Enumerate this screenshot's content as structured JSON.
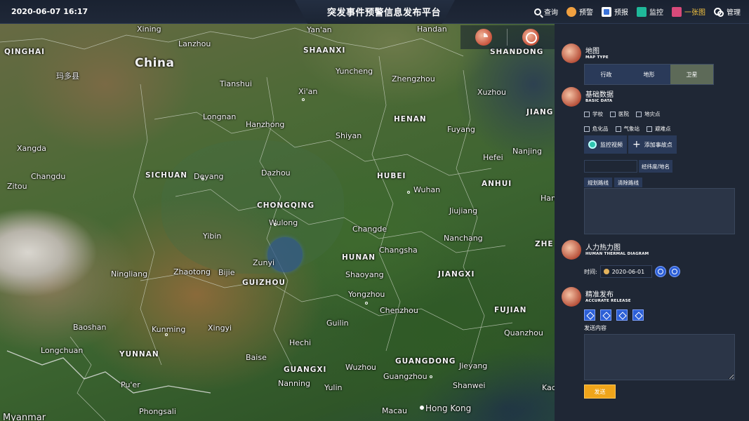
{
  "header": {
    "datetime": "2020-06-07 16:17",
    "title": "突发事件预警信息发布平台",
    "nav": [
      {
        "label": "查询",
        "icon": "search-icon"
      },
      {
        "label": "预警",
        "icon": "warning-icon"
      },
      {
        "label": "预报",
        "icon": "forecast-icon"
      },
      {
        "label": "监控",
        "icon": "monitor-icon"
      },
      {
        "label": "一张图",
        "icon": "map-icon",
        "active": true
      },
      {
        "label": "管理",
        "icon": "manage-icon"
      }
    ]
  },
  "map": {
    "labels": {
      "xining": "Xining",
      "lanzhou": "Lanzhou",
      "yanan": "Yan'an",
      "handan": "Handan",
      "qinghai": "QINGHAI",
      "shaanxi": "SHAANXI",
      "shandong": "SHANDONG",
      "china": "China",
      "maduo": "玛多县",
      "yuncheng": "Yuncheng",
      "zhengzhou": "Zhengzhou",
      "tianshui": "Tianshui",
      "xian": "Xi'an",
      "xuzhou": "Xuzhou",
      "longnan": "Longnan",
      "hanzhong": "Hanzhong",
      "henan": "HENAN",
      "jiangsu": "JIANG",
      "fuyang": "Fuyang",
      "shiyan": "Shiyan",
      "xiangda": "Xangda",
      "hefei": "Hefei",
      "nanjing": "Nanjing",
      "sichuan": "SICHUAN",
      "deyang": "Deyang",
      "dazhou": "Dazhou",
      "hubei": "HUBEI",
      "anhui": "ANHUI",
      "changdu": "Changdu",
      "zitou": "Zitou",
      "wuhan": "Wuhan",
      "hangzhou_partial": "Han",
      "chongqing": "CHONGQING",
      "jiujiang": "Jiujiang",
      "wulong": "Wulong",
      "changde": "Changde",
      "yibin": "Yibin",
      "changsha": "Changsha",
      "nanchang": "Nanchang",
      "zhejiang": "ZHE",
      "zunyi": "Zunyi",
      "hunan": "HUNAN",
      "ningliang": "Ningliang",
      "zhaotong": "Zhaotong",
      "bijie": "Bijie",
      "guizhou": "GUIZHOU",
      "shaoyang": "Shaoyang",
      "jiangxi": "JIANGXI",
      "yongzhou": "Yongzhou",
      "chenzhou": "Chenzhou",
      "fujian": "FUJIAN",
      "baoshan": "Baoshan",
      "kunming": "Kunming",
      "xingyi": "Xingyi",
      "guilin": "Guilin",
      "quanzhou": "Quanzhou",
      "longchuan": "Longchuan",
      "yunnan": "YUNNAN",
      "hechi": "Hechi",
      "baise": "Baise",
      "guangxi": "GUANGXI",
      "guangdong": "GUANGDONG",
      "wuzhou": "Wuzhou",
      "jieyang": "Jieyang",
      "puer": "Pu'er",
      "nanning": "Nanning",
      "yulin": "Yulin",
      "guangzhou": "Guangzhou",
      "shanwei": "Shanwei",
      "kaohsiung": "Kac",
      "phongsali": "Phongsali",
      "macau": "Macau",
      "hongkong": "Hong Kong",
      "myanmar": "Myanmar"
    }
  },
  "panel": {
    "map_type": {
      "title": "地图",
      "subtitle": "MAP TYPE",
      "options": [
        "行政",
        "地形",
        "卫星"
      ],
      "selected": "卫星"
    },
    "basic_data": {
      "title": "基础数据",
      "subtitle": "BASIC DATA",
      "row1": [
        "学校",
        "医院",
        "地灾点"
      ],
      "row2": [
        "危化品",
        "气象站",
        "避难点"
      ],
      "monitor_video": "监控视频",
      "add_accident": "添加事故点",
      "coord_placeholder": "",
      "coord_button": "经纬度/地名",
      "plan_route": "规划路线",
      "clear_route": "清除路线"
    },
    "heatmap": {
      "title": "人力热力图",
      "subtitle": "HUMAN THERMAL DIAGRAM",
      "time_label": "时间:",
      "date": "2020-06-01"
    },
    "release": {
      "title": "精准发布",
      "subtitle": "ACCURATE RELEASE",
      "content_label": "发送内容",
      "send": "发送"
    }
  }
}
